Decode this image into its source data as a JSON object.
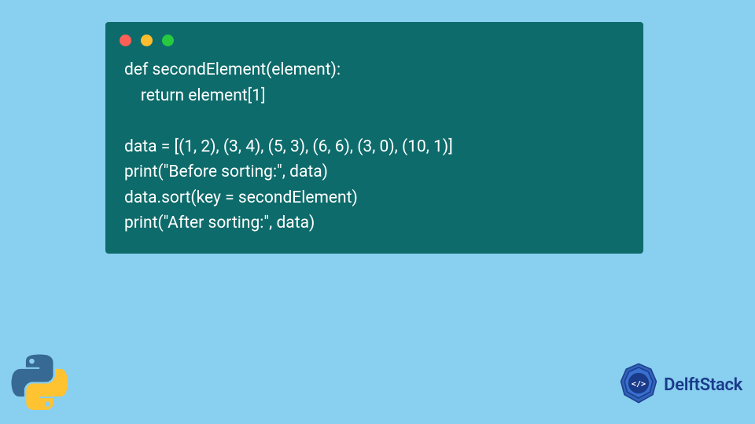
{
  "code": {
    "line1": "def secondElement(element):",
    "line2": "    return element[1]",
    "line3": "",
    "line4": "data = [(1, 2), (3, 4), (5, 3), (6, 6), (3, 0), (10, 1)]",
    "line5": "print(\"Before sorting:\", data)",
    "line6": "data.sort(key = secondElement)",
    "line7": "print(\"After sorting:\", data)"
  },
  "branding": {
    "delft_label": "DelftStack"
  },
  "window": {
    "dot_colors": [
      "#ff5f56",
      "#ffbd2e",
      "#27c93f"
    ]
  }
}
